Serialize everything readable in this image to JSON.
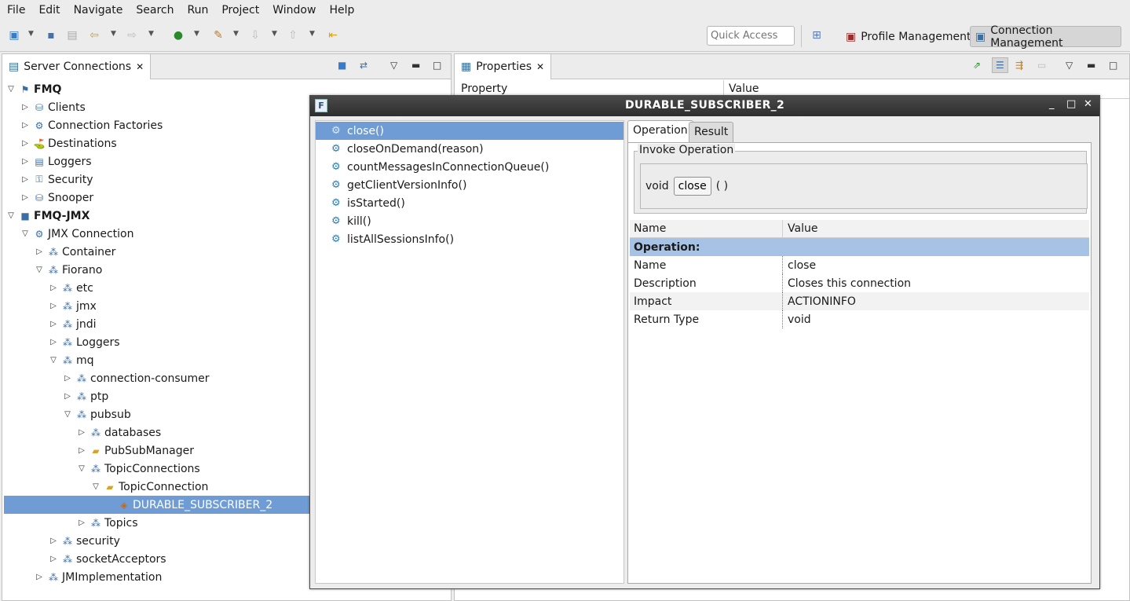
{
  "menu": [
    "File",
    "Edit",
    "Navigate",
    "Search",
    "Run",
    "Project",
    "Window",
    "Help"
  ],
  "toolbar": {
    "quick_access_placeholder": "Quick Access",
    "perspectives": [
      "Profile Management",
      "Connection Management"
    ]
  },
  "server_view": {
    "tab_title": "Server Connections",
    "tree": [
      {
        "label": "FMQ",
        "bold": true
      },
      {
        "label": "Clients"
      },
      {
        "label": "Connection Factories"
      },
      {
        "label": "Destinations"
      },
      {
        "label": "Loggers"
      },
      {
        "label": "Security"
      },
      {
        "label": "Snooper"
      },
      {
        "label": "FMQ-JMX",
        "bold": true
      },
      {
        "label": "JMX Connection"
      },
      {
        "label": "Container"
      },
      {
        "label": "Fiorano"
      },
      {
        "label": "etc"
      },
      {
        "label": "jmx"
      },
      {
        "label": "jndi"
      },
      {
        "label": "Loggers"
      },
      {
        "label": "mq"
      },
      {
        "label": "connection-consumer"
      },
      {
        "label": "ptp"
      },
      {
        "label": "pubsub"
      },
      {
        "label": "databases"
      },
      {
        "label": "PubSubManager"
      },
      {
        "label": "TopicConnections"
      },
      {
        "label": "TopicConnection"
      },
      {
        "label": "DURABLE_SUBSCRIBER_2",
        "selected": true
      },
      {
        "label": "Topics"
      },
      {
        "label": "security"
      },
      {
        "label": "socketAcceptors"
      },
      {
        "label": "JMImplementation"
      }
    ]
  },
  "properties_view": {
    "tab_title": "Properties",
    "col_property": "Property",
    "col_value": "Value"
  },
  "dialog": {
    "title": "DURABLE_SUBSCRIBER_2",
    "operations": [
      "close()",
      "closeOnDemand(reason)",
      "countMessagesInConnectionQueue()",
      "getClientVersionInfo()",
      "isStarted()",
      "kill()",
      "listAllSessionsInfo()"
    ],
    "tabs": [
      "Operation",
      "Result"
    ],
    "invoke": {
      "legend": "Invoke Operation",
      "return_type": "void",
      "button": "close",
      "params": "( )"
    },
    "table": {
      "col_name": "Name",
      "col_value": "Value",
      "group": "Operation:",
      "rows": [
        {
          "name": "Name",
          "value": "close"
        },
        {
          "name": "Description",
          "value": "Closes this connection"
        },
        {
          "name": "Impact",
          "value": "ACTIONINFO"
        },
        {
          "name": "Return Type",
          "value": "void"
        }
      ]
    }
  }
}
